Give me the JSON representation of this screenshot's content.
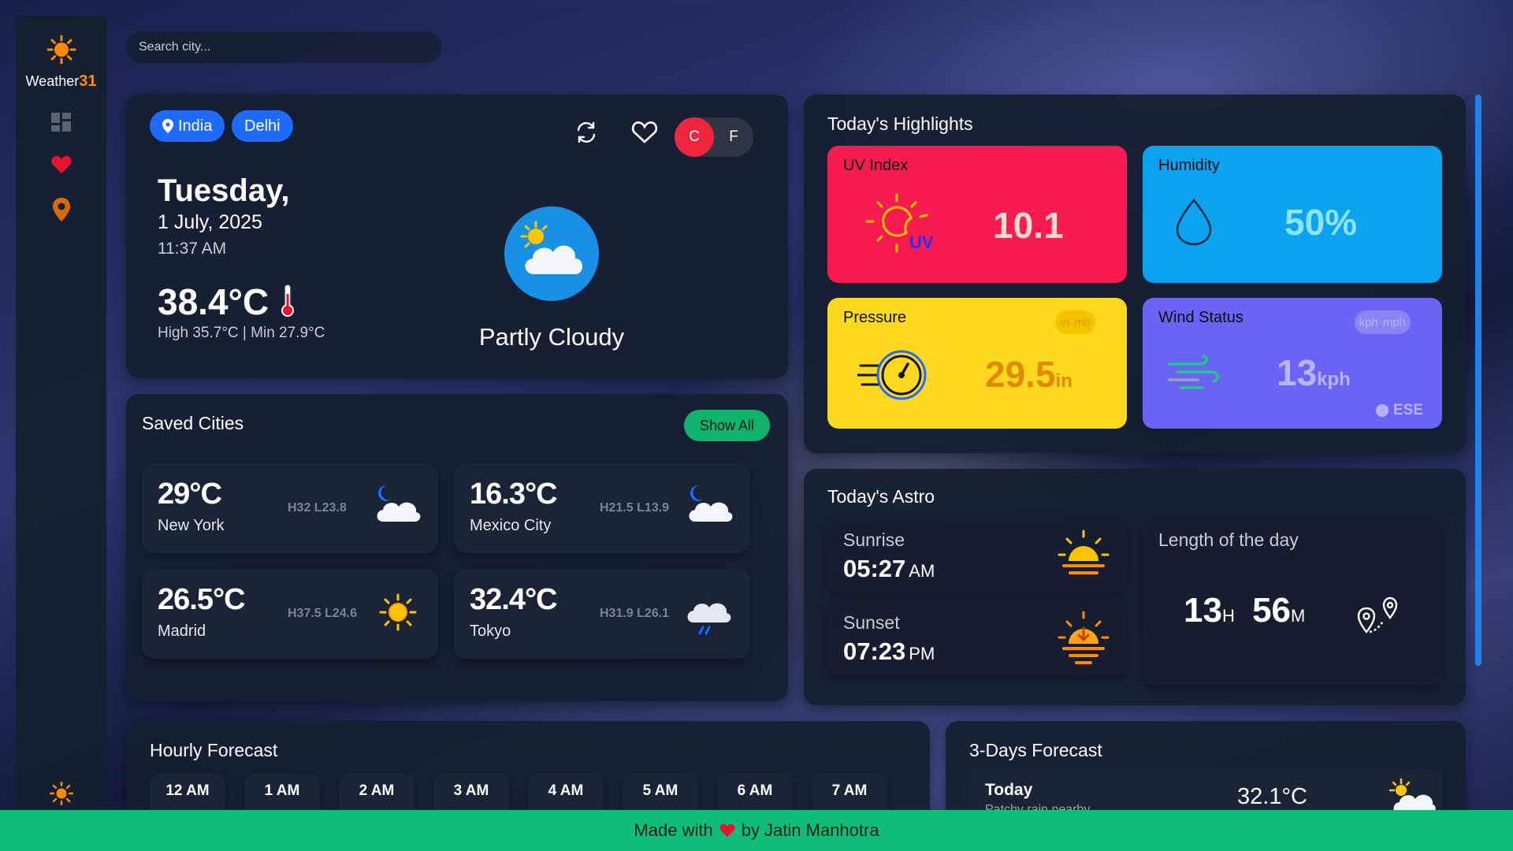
{
  "app": {
    "logo_name": "Weather",
    "logo_num": "31"
  },
  "search": {
    "placeholder": "Search city..."
  },
  "current": {
    "country": "India",
    "city": "Delhi",
    "day": "Tuesday,",
    "date": "1 July, 2025",
    "time": "11:37 AM",
    "temp": "38.4°C",
    "high_low": "High 35.7°C | Min 27.9°C",
    "condition": "Partly Cloudy",
    "unit_c": "C",
    "unit_f": "F"
  },
  "saved": {
    "title": "Saved Cities",
    "show_all": "Show All",
    "cities": [
      {
        "temp": "29°C",
        "name": "New York",
        "hl": "H32 L23.8",
        "icon": "moon-cloud-icon"
      },
      {
        "temp": "16.3°C",
        "name": "Mexico City",
        "hl": "H21.5 L13.9",
        "icon": "moon-cloud-icon"
      },
      {
        "temp": "26.5°C",
        "name": "Madrid",
        "hl": "H37.5 L24.6",
        "icon": "sun-icon"
      },
      {
        "temp": "32.4°C",
        "name": "Tokyo",
        "hl": "H31.9 L26.1",
        "icon": "rain-cloud-icon"
      }
    ]
  },
  "highlights": {
    "title": "Today's Highlights",
    "uv": {
      "label": "UV Index",
      "value": "10.1",
      "badge": "UV",
      "color": "#f61c4f"
    },
    "humidity": {
      "label": "Humidity",
      "value": "50%",
      "color": "#0ba2f0"
    },
    "pressure": {
      "label": "Pressure",
      "value": "29.5",
      "unit": "in",
      "toggle_a": "in",
      "toggle_b": "mb",
      "color": "#fcd91f"
    },
    "wind": {
      "label": "Wind Status",
      "value": "13",
      "unit": "kph",
      "toggle_a": "kph",
      "toggle_b": "mph",
      "dir": "ESE",
      "color": "#6b63f5"
    }
  },
  "astro": {
    "title": "Today's Astro",
    "sunrise_label": "Sunrise",
    "sunrise_time": "05:27",
    "sunrise_ap": "AM",
    "sunset_label": "Sunset",
    "sunset_time": "07:23",
    "sunset_ap": "PM",
    "length_label": "Length of the day",
    "length_h": "13",
    "length_h_unit": "H",
    "length_m": "56",
    "length_m_unit": "M"
  },
  "hourly": {
    "title": "Hourly Forecast",
    "hours": [
      "12 AM",
      "1 AM",
      "2 AM",
      "3 AM",
      "4 AM",
      "5 AM",
      "6 AM",
      "7 AM"
    ]
  },
  "forecast": {
    "title": "3-Days Forecast",
    "day": "Today",
    "sub": "Patchy rain nearby",
    "temp": "32.1°C"
  },
  "footer": {
    "made_with": "Made with",
    "by": "by Jatin Manhotra"
  }
}
